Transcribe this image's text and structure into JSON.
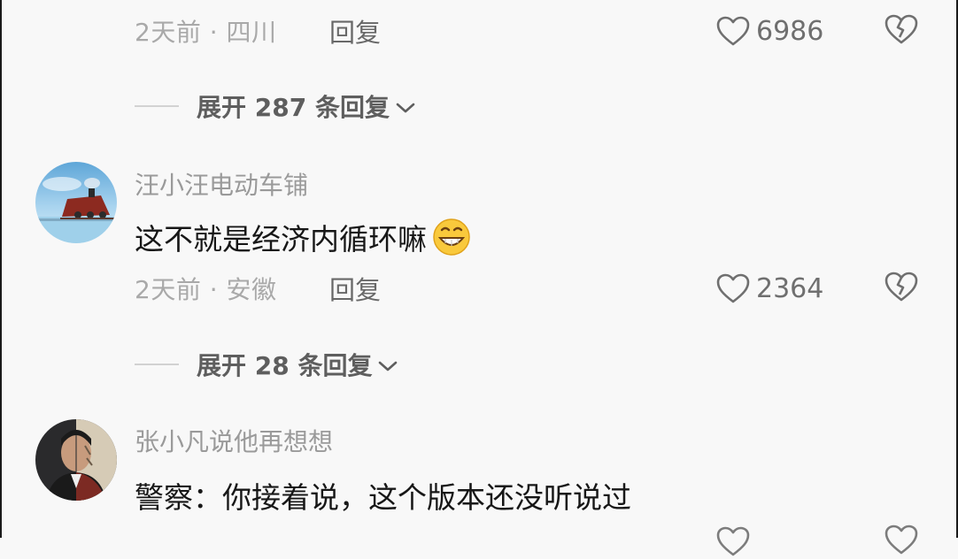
{
  "comments": [
    {
      "meta": "2天前 · 四川",
      "reply_label": "回复",
      "likes": "6986",
      "expand_label": "展开 287 条回复"
    },
    {
      "username": "汪小汪电动车铺",
      "text": "这不就是经济内循环嘛",
      "emoji": "grinning-face-emoji",
      "meta": "2天前 · 安徽",
      "reply_label": "回复",
      "likes": "2364",
      "expand_label": "展开 28 条回复"
    },
    {
      "username": "张小凡说他再想想",
      "text": "警察：你接着说，这个版本还没听说过"
    }
  ],
  "colors": {
    "background": "#f8f8f8",
    "text_primary": "#171717",
    "text_secondary": "#a9a9a9",
    "icon": "#6f6f6f"
  },
  "icons": [
    "heart-outline-icon",
    "broken-heart-icon",
    "chevron-down-icon"
  ]
}
